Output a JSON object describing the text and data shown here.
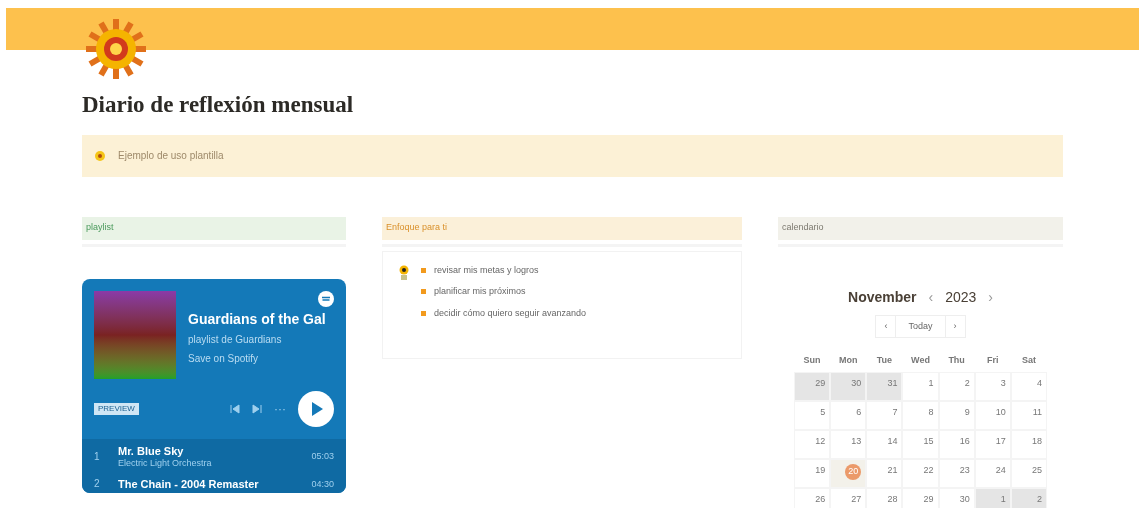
{
  "page": {
    "title": "Diario de reflexión mensual"
  },
  "callout": {
    "text": "Ejemplo de uso plantilla"
  },
  "columns": [
    {
      "kind": "playlist",
      "header": "playlist",
      "color": "#e9f3e6",
      "player": {
        "title": "Guardians of the Gal",
        "subtitle": "playlist de Guardians",
        "save": "Save on Spotify",
        "badge": "PREVIEW",
        "more": "···",
        "tracks": [
          {
            "number": "1",
            "title": "Mr. Blue Sky",
            "artist": "Electric Light Orchestra",
            "duration": "05:03"
          },
          {
            "number": "2",
            "title": "The Chain - 2004 Remaster",
            "duration": "04:30"
          }
        ]
      }
    },
    {
      "kind": "list",
      "header": "Enfoque para ti",
      "color": "#fbf0d9",
      "items": [
        "revisar mis metas y logros",
        "planificar mis próximos",
        "decidir cómo quiero seguir avanzando"
      ]
    },
    {
      "kind": "calendar",
      "header": "calendario",
      "color": "#f2f1ea",
      "calendar": {
        "month": "November",
        "prev": "‹",
        "year": "2023",
        "next": "›",
        "back": "‹",
        "today": "Today",
        "forward": "›",
        "weekdays": [
          "Sun",
          "Mon",
          "Tue",
          "Wed",
          "Thu",
          "Fri",
          "Sat"
        ],
        "weeks": [
          [
            {
              "day": "29",
              "outside": true,
              "today": false
            },
            {
              "day": "30",
              "outside": true,
              "today": false
            },
            {
              "day": "31",
              "outside": true,
              "today": false
            },
            {
              "day": "1",
              "outside": false,
              "today": false
            },
            {
              "day": "2",
              "outside": false,
              "today": false
            },
            {
              "day": "3",
              "outside": false,
              "today": false
            },
            {
              "day": "4",
              "outside": false,
              "today": false
            }
          ],
          [
            {
              "day": "5",
              "outside": false,
              "today": false
            },
            {
              "day": "6",
              "outside": false,
              "today": false
            },
            {
              "day": "7",
              "outside": false,
              "today": false
            },
            {
              "day": "8",
              "outside": false,
              "today": false
            },
            {
              "day": "9",
              "outside": false,
              "today": false
            },
            {
              "day": "10",
              "outside": false,
              "today": false
            },
            {
              "day": "11",
              "outside": false,
              "today": false
            }
          ],
          [
            {
              "day": "12",
              "outside": false,
              "today": false
            },
            {
              "day": "13",
              "outside": false,
              "today": false
            },
            {
              "day": "14",
              "outside": false,
              "today": false
            },
            {
              "day": "15",
              "outside": false,
              "today": false
            },
            {
              "day": "16",
              "outside": false,
              "today": false
            },
            {
              "day": "17",
              "outside": false,
              "today": false
            },
            {
              "day": "18",
              "outside": false,
              "today": false
            }
          ],
          [
            {
              "day": "19",
              "outside": false,
              "today": false
            },
            {
              "day": "20",
              "outside": false,
              "today": true
            },
            {
              "day": "21",
              "outside": false,
              "today": false
            },
            {
              "day": "22",
              "outside": false,
              "today": false
            },
            {
              "day": "23",
              "outside": false,
              "today": false
            },
            {
              "day": "24",
              "outside": false,
              "today": false
            },
            {
              "day": "25",
              "outside": false,
              "today": false
            }
          ],
          [
            {
              "day": "26",
              "outside": false,
              "today": false
            },
            {
              "day": "27",
              "outside": false,
              "today": false
            },
            {
              "day": "28",
              "outside": false,
              "today": false
            },
            {
              "day": "29",
              "outside": false,
              "today": false
            },
            {
              "day": "30",
              "outside": false,
              "today": false
            },
            {
              "day": "1",
              "outside": true,
              "today": false
            },
            {
              "day": "2",
              "outside": true,
              "today": false
            }
          ]
        ]
      }
    }
  ]
}
